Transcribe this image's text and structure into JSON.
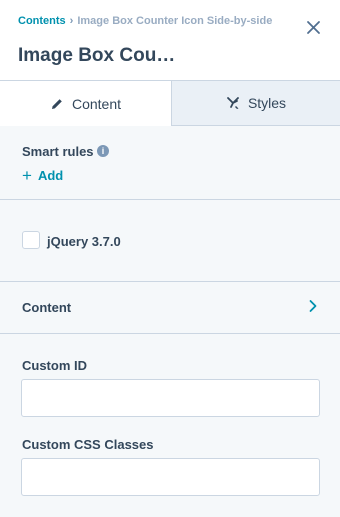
{
  "header": {
    "breadcrumb": {
      "root": "Contents",
      "separator": "›",
      "current": "Image Box Counter Icon Side-by-side"
    },
    "title": "Image Box Cou…",
    "close_icon": "close-icon"
  },
  "tabs": [
    {
      "label": "Content",
      "icon": "pencil-icon",
      "active": true
    },
    {
      "label": "Styles",
      "icon": "brush-icon",
      "active": false
    }
  ],
  "smart_rules": {
    "label": "Smart rules",
    "info_glyph": "i",
    "add_label": "Add",
    "add_glyph": "+"
  },
  "dependencies": {
    "jquery_label": "jQuery 3.7.0",
    "jquery_checked": false
  },
  "content_section": {
    "label": "Content"
  },
  "fields": {
    "custom_id": {
      "label": "Custom ID",
      "value": ""
    },
    "custom_css": {
      "label": "Custom CSS Classes",
      "value": ""
    }
  },
  "colors": {
    "accent": "#0091ae",
    "text": "#33475b",
    "muted": "#99acc2",
    "border": "#cbd6e2",
    "section_bg": "#f5f8fa",
    "inactive_tab_bg": "#eaf0f6"
  }
}
